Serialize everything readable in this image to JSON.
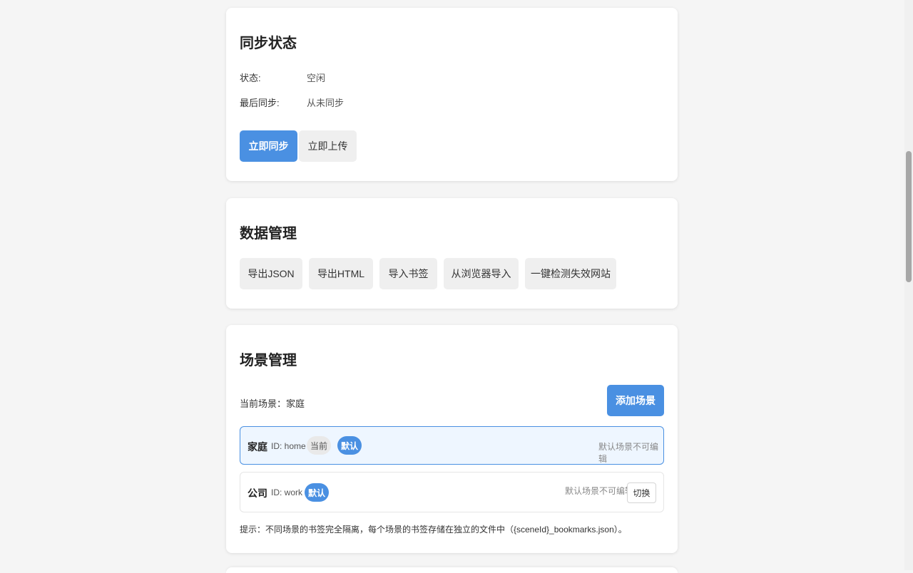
{
  "sync": {
    "title": "同步状态",
    "status_label": "状态:",
    "status_value": "空闲",
    "last_sync_label": "最后同步:",
    "last_sync_value": "从未同步",
    "sync_now": "立即同步",
    "upload_now": "立即上传"
  },
  "data_mgmt": {
    "title": "数据管理",
    "buttons": [
      "导出JSON",
      "导出HTML",
      "导入书签",
      "从浏览器导入",
      "一键检测失效网站"
    ]
  },
  "scene": {
    "title": "场景管理",
    "current_label": "当前场景：",
    "current_value": "家庭",
    "add_button": "添加场景",
    "items": [
      {
        "name": "家庭",
        "id_text": "ID: home",
        "current_tag": "当前",
        "default_tag": "默认",
        "note": "默认场景不可编辑"
      },
      {
        "name": "公司",
        "id_text": "ID: work",
        "default_tag": "默认",
        "note": "默认场景不可编辑",
        "switch_label": "切换"
      }
    ],
    "hint": "提示：不同场景的书签完全隔离，每个场景的书签存储在独立的文件中（{sceneId}_bookmarks.json）。"
  },
  "colors": {
    "primary": "#4a90e2",
    "background": "#f5f5f5",
    "card": "#ffffff"
  }
}
